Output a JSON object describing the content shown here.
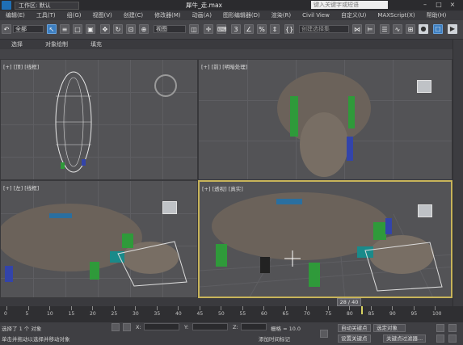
{
  "titlebar": {
    "workspace": "工作区: 默认",
    "title": "犀牛_走.max",
    "search_placeholder": "键入关键字或短语"
  },
  "menu": [
    "编辑(E)",
    "工具(T)",
    "组(G)",
    "视图(V)",
    "创建(C)",
    "修改器(M)",
    "动画(A)",
    "图形编辑器(D)",
    "渲染(R)",
    "Civil View",
    "自定义(U)",
    "MAXScript(X)",
    "帮助(H)"
  ],
  "toolbar": {
    "filter": "全部",
    "refcoord": "视图",
    "selset_placeholder": "创建选择集"
  },
  "subtabs": [
    "选择",
    "对象绘制",
    "填充"
  ],
  "viewports": {
    "top": "[+] [顶] [线框]",
    "front": "[+] [前] [明暗处理]",
    "left": "[+] [左] [线框]",
    "persp": "[+] [透视] [真实]"
  },
  "timeslider": {
    "current": "28 / 40"
  },
  "trackbar": {
    "ticks": [
      "0",
      "5",
      "10",
      "15",
      "20",
      "25",
      "30",
      "35",
      "40",
      "45",
      "50",
      "55",
      "60",
      "65",
      "70",
      "75",
      "80",
      "85",
      "90",
      "95",
      "100"
    ]
  },
  "status": {
    "sel": "选择了 1 个 对象",
    "prompt": "单击并拖动以选择并移动对象",
    "x_label": "X:",
    "y_label": "Y:",
    "z_label": "Z:",
    "grid": "栅格 = 10.0",
    "autokey": "自动关键点",
    "selected": "选定对象",
    "setkey": "设置关键点",
    "keyfilter": "关键点过滤器...",
    "addtime": "添加时间标记"
  },
  "colors": {
    "active_border": "#c8b45a",
    "accent_blue": "#3d7fc1",
    "rhino": "#6b625a"
  }
}
